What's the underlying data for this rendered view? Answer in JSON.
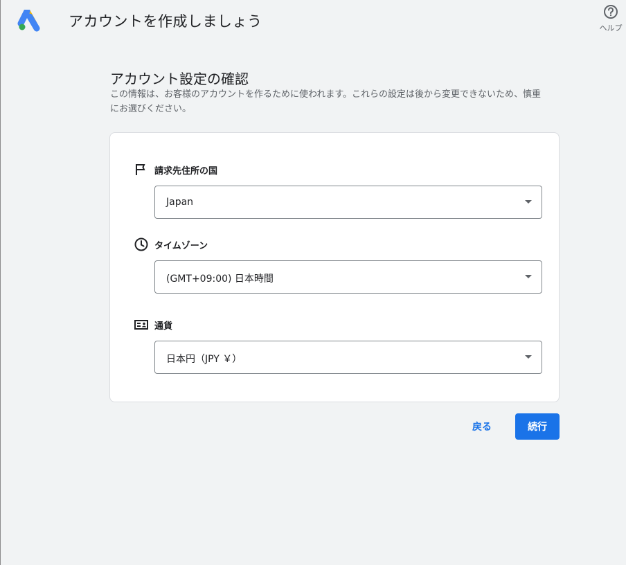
{
  "header": {
    "title": "アカウントを作成しましょう",
    "help_label": "ヘルプ"
  },
  "main": {
    "title": "アカウント設定の確認",
    "description": "この情報は、お客様のアカウントを作るために使われます。これらの設定は後から変更できないため、慎重にお選びください。"
  },
  "fields": {
    "country": {
      "label": "請求先住所の国",
      "value": "Japan",
      "icon": "flag-icon"
    },
    "timezone": {
      "label": "タイムゾーン",
      "value": "(GMT+09:00) 日本時間",
      "icon": "clock-icon"
    },
    "currency": {
      "label": "通貨",
      "value": "日本円（JPY ￥）",
      "icon": "currency-icon"
    }
  },
  "actions": {
    "back_label": "戻る",
    "continue_label": "続行"
  },
  "colors": {
    "accent": "#1a73e8",
    "background": "#f1f3f4",
    "card": "#ffffff"
  }
}
